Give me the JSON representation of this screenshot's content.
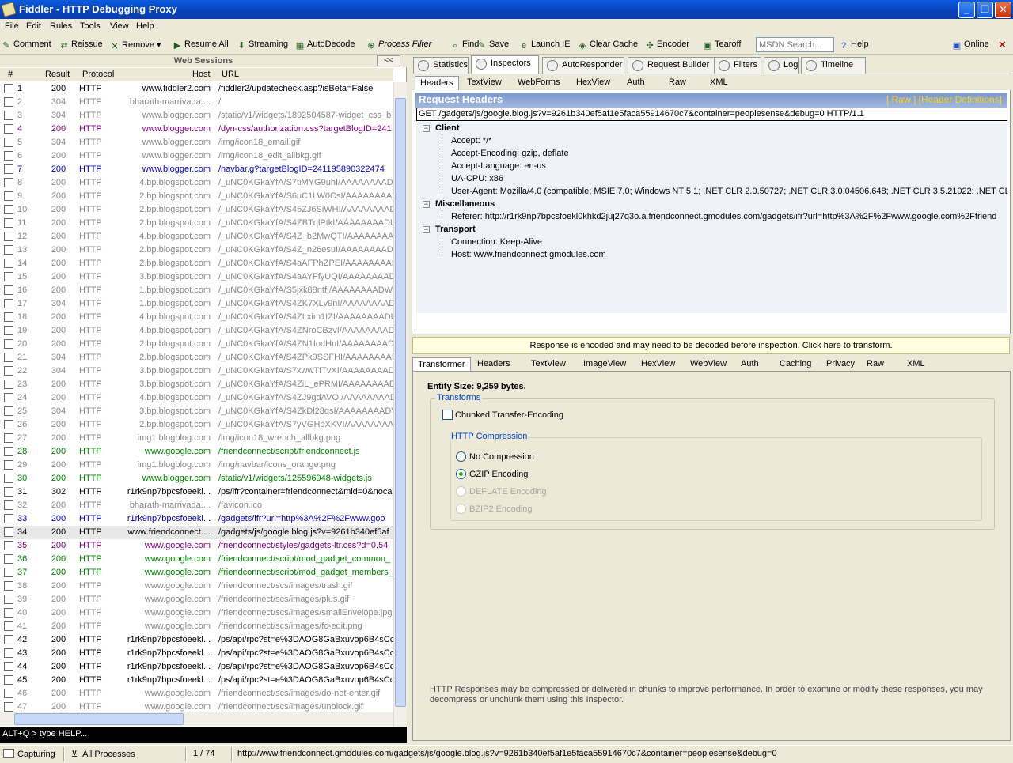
{
  "window": {
    "title": "Fiddler - HTTP Debugging Proxy",
    "controls": [
      "_",
      "❐",
      "✕"
    ]
  },
  "menu": [
    "File",
    "Edit",
    "Rules",
    "Tools",
    "View",
    "Help"
  ],
  "toolbar": {
    "items": [
      {
        "label": "Comment",
        "icon": "comment-icon",
        "glyph": "✎"
      },
      {
        "label": "Reissue",
        "icon": "reissue-icon",
        "glyph": "⇄"
      },
      {
        "label": "Remove ▾",
        "icon": "remove-icon",
        "glyph": "✕"
      },
      {
        "label": "Resume All",
        "icon": "resume-icon",
        "glyph": "▶"
      },
      {
        "label": "Streaming",
        "icon": "streaming-icon",
        "glyph": "⬇"
      },
      {
        "label": "AutoDecode",
        "icon": "autodecode-icon",
        "glyph": "▦"
      },
      {
        "label": "Process Filter",
        "icon": "process-filter-icon",
        "glyph": "⊕"
      },
      {
        "label": "Find",
        "icon": "find-icon",
        "glyph": "⌕"
      },
      {
        "label": "Save",
        "icon": "save-icon",
        "glyph": "✎"
      },
      {
        "label": "Launch IE",
        "icon": "ie-icon",
        "glyph": "e"
      },
      {
        "label": "Clear Cache",
        "icon": "clear-cache-icon",
        "glyph": "◈"
      },
      {
        "label": "Encoder",
        "icon": "encoder-icon",
        "glyph": "✣"
      },
      {
        "label": "Tearoff",
        "icon": "tearoff-icon",
        "glyph": "▣"
      }
    ],
    "msdn_placeholder": "MSDN Search...",
    "help": "Help",
    "online": "Online",
    "close": "✕"
  },
  "sessions": {
    "title": "Web Sessions",
    "collapse": "<<",
    "columns": [
      "#",
      "Result",
      "Protocol",
      "Host",
      "URL"
    ],
    "rows": [
      {
        "n": "1",
        "r": "200",
        "p": "HTTP",
        "h": "www.fiddler2.com",
        "u": "/fiddler2/updatecheck.asp?isBeta=False",
        "c": "#000"
      },
      {
        "n": "2",
        "r": "304",
        "p": "HTTP",
        "h": "bharath-marrivada....",
        "u": "/",
        "c": "#888"
      },
      {
        "n": "3",
        "r": "304",
        "p": "HTTP",
        "h": "www.blogger.com",
        "u": "/static/v1/widgets/1892504587-widget_css_b",
        "c": "#888"
      },
      {
        "n": "4",
        "r": "200",
        "p": "HTTP",
        "h": "www.blogger.com",
        "u": "/dyn-css/authorization.css?targetBlogID=241",
        "c": "#800080"
      },
      {
        "n": "5",
        "r": "304",
        "p": "HTTP",
        "h": "www.blogger.com",
        "u": "/img/icon18_email.gif",
        "c": "#888"
      },
      {
        "n": "6",
        "r": "200",
        "p": "HTTP",
        "h": "www.blogger.com",
        "u": "/img/icon18_edit_allbkg.gif",
        "c": "#888"
      },
      {
        "n": "7",
        "r": "200",
        "p": "HTTP",
        "h": "www.blogger.com",
        "u": "/navbar.g?targetBlogID=241195890322474",
        "c": "#0000c0"
      },
      {
        "n": "8",
        "r": "200",
        "p": "HTTP",
        "h": "4.bp.blogspot.com",
        "u": "/_uNC0KGkaYfA/S7tiMYG9uhI/AAAAAAAADXY",
        "c": "#888"
      },
      {
        "n": "9",
        "r": "200",
        "p": "HTTP",
        "h": "2.bp.blogspot.com",
        "u": "/_uNC0KGkaYfA/S6uC1LW0CsI/AAAAAAAADX",
        "c": "#888"
      },
      {
        "n": "10",
        "r": "200",
        "p": "HTTP",
        "h": "2.bp.blogspot.com",
        "u": "/_uNC0KGkaYfA/S45ZJ6SiWHI/AAAAAAAADW",
        "c": "#888"
      },
      {
        "n": "11",
        "r": "200",
        "p": "HTTP",
        "h": "2.bp.blogspot.com",
        "u": "/_uNC0KGkaYfA/S4ZBTqlPtkI/AAAAAAAADUA",
        "c": "#888"
      },
      {
        "n": "12",
        "r": "200",
        "p": "HTTP",
        "h": "4.bp.blogspot.com",
        "u": "/_uNC0KGkaYfA/S4Z_b2MwQTI/AAAAAAAADV",
        "c": "#888"
      },
      {
        "n": "13",
        "r": "200",
        "p": "HTTP",
        "h": "2.bp.blogspot.com",
        "u": "/_uNC0KGkaYfA/S4Z_n26esuI/AAAAAAAADV",
        "c": "#888"
      },
      {
        "n": "14",
        "r": "200",
        "p": "HTTP",
        "h": "2.bp.blogspot.com",
        "u": "/_uNC0KGkaYfA/S4aAFPhZPEI/AAAAAAAADW",
        "c": "#888"
      },
      {
        "n": "15",
        "r": "200",
        "p": "HTTP",
        "h": "3.bp.blogspot.com",
        "u": "/_uNC0KGkaYfA/S4aAYFfyUQI/AAAAAAAADW",
        "c": "#888"
      },
      {
        "n": "16",
        "r": "200",
        "p": "HTTP",
        "h": "1.bp.blogspot.com",
        "u": "/_uNC0KGkaYfA/S5jxk88ntfI/AAAAAAAADW0",
        "c": "#888"
      },
      {
        "n": "17",
        "r": "304",
        "p": "HTTP",
        "h": "1.bp.blogspot.com",
        "u": "/_uNC0KGkaYfA/S4ZK7XLv9nI/AAAAAAAADU",
        "c": "#888"
      },
      {
        "n": "18",
        "r": "200",
        "p": "HTTP",
        "h": "4.bp.blogspot.com",
        "u": "/_uNC0KGkaYfA/S4ZLxim1IZI/AAAAAAAADUo",
        "c": "#888"
      },
      {
        "n": "19",
        "r": "200",
        "p": "HTTP",
        "h": "4.bp.blogspot.com",
        "u": "/_uNC0KGkaYfA/S4ZNroCBzvI/AAAAAAAADU",
        "c": "#888"
      },
      {
        "n": "20",
        "r": "200",
        "p": "HTTP",
        "h": "2.bp.blogspot.com",
        "u": "/_uNC0KGkaYfA/S4ZN1IodHuI/AAAAAAAADU",
        "c": "#888"
      },
      {
        "n": "21",
        "r": "304",
        "p": "HTTP",
        "h": "2.bp.blogspot.com",
        "u": "/_uNC0KGkaYfA/S4ZPk9SSFHI/AAAAAAAADW",
        "c": "#888"
      },
      {
        "n": "22",
        "r": "304",
        "p": "HTTP",
        "h": "3.bp.blogspot.com",
        "u": "/_uNC0KGkaYfA/S7xwwTfTvXI/AAAAAAAADY",
        "c": "#888"
      },
      {
        "n": "23",
        "r": "200",
        "p": "HTTP",
        "h": "3.bp.blogspot.com",
        "u": "/_uNC0KGkaYfA/S4ZiL_ePRMI/AAAAAAAADV",
        "c": "#888"
      },
      {
        "n": "24",
        "r": "200",
        "p": "HTTP",
        "h": "4.bp.blogspot.com",
        "u": "/_uNC0KGkaYfA/S4ZJ9gdAVOI/AAAAAAAADW",
        "c": "#888"
      },
      {
        "n": "25",
        "r": "304",
        "p": "HTTP",
        "h": "3.bp.blogspot.com",
        "u": "/_uNC0KGkaYfA/S4ZkDl28qsI/AAAAAAAADVo",
        "c": "#888"
      },
      {
        "n": "26",
        "r": "200",
        "p": "HTTP",
        "h": "2.bp.blogspot.com",
        "u": "/_uNC0KGkaYfA/S7yVGHoXKVI/AAAAAAAADY",
        "c": "#888"
      },
      {
        "n": "27",
        "r": "200",
        "p": "HTTP",
        "h": "img1.blogblog.com",
        "u": "/img/icon18_wrench_allbkg.png",
        "c": "#888"
      },
      {
        "n": "28",
        "r": "200",
        "p": "HTTP",
        "h": "www.google.com",
        "u": "/friendconnect/script/friendconnect.js",
        "c": "#008000"
      },
      {
        "n": "29",
        "r": "200",
        "p": "HTTP",
        "h": "img1.blogblog.com",
        "u": "/img/navbar/icons_orange.png",
        "c": "#888"
      },
      {
        "n": "30",
        "r": "200",
        "p": "HTTP",
        "h": "www.blogger.com",
        "u": "/static/v1/widgets/125596948-widgets.js",
        "c": "#008000"
      },
      {
        "n": "31",
        "r": "302",
        "p": "HTTP",
        "h": "r1rk9np7bpcsfoeekl...",
        "u": "/ps/ifr?container=friendconnect&mid=0&noca",
        "c": "#000"
      },
      {
        "n": "32",
        "r": "200",
        "p": "HTTP",
        "h": "bharath-marrivada....",
        "u": "/favicon.ico",
        "c": "#888"
      },
      {
        "n": "33",
        "r": "200",
        "p": "HTTP",
        "h": "r1rk9np7bpcsfoeekl...",
        "u": "/gadgets/ifr?url=http%3A%2F%2Fwww.goo",
        "c": "#0000c0"
      },
      {
        "n": "34",
        "r": "200",
        "p": "HTTP",
        "h": "www.friendconnect....",
        "u": "/gadgets/js/google.blog.js?v=9261b340ef5af",
        "c": "#000",
        "sel": true
      },
      {
        "n": "35",
        "r": "200",
        "p": "HTTP",
        "h": "www.google.com",
        "u": "/friendconnect/styles/gadgets-ltr.css?d=0.54",
        "c": "#800080"
      },
      {
        "n": "36",
        "r": "200",
        "p": "HTTP",
        "h": "www.google.com",
        "u": "/friendconnect/script/mod_gadget_common_",
        "c": "#008000"
      },
      {
        "n": "37",
        "r": "200",
        "p": "HTTP",
        "h": "www.google.com",
        "u": "/friendconnect/script/mod_gadget_members_",
        "c": "#008000"
      },
      {
        "n": "38",
        "r": "200",
        "p": "HTTP",
        "h": "www.google.com",
        "u": "/friendconnect/scs/images/trash.gif",
        "c": "#888"
      },
      {
        "n": "39",
        "r": "200",
        "p": "HTTP",
        "h": "www.google.com",
        "u": "/friendconnect/scs/images/plus.gif",
        "c": "#888"
      },
      {
        "n": "40",
        "r": "200",
        "p": "HTTP",
        "h": "www.google.com",
        "u": "/friendconnect/scs/images/smallEnvelope.jpg",
        "c": "#888"
      },
      {
        "n": "41",
        "r": "200",
        "p": "HTTP",
        "h": "www.google.com",
        "u": "/friendconnect/scs/images/fc-edit.png",
        "c": "#888"
      },
      {
        "n": "42",
        "r": "200",
        "p": "HTTP",
        "h": "r1rk9np7bpcsfoeekl...",
        "u": "/ps/api/rpc?st=e%3DAOG8GaBxuvop6B4sCcj",
        "c": "#000"
      },
      {
        "n": "43",
        "r": "200",
        "p": "HTTP",
        "h": "r1rk9np7bpcsfoeekl...",
        "u": "/ps/api/rpc?st=e%3DAOG8GaBxuvop6B4sCcj",
        "c": "#000"
      },
      {
        "n": "44",
        "r": "200",
        "p": "HTTP",
        "h": "r1rk9np7bpcsfoeekl...",
        "u": "/ps/api/rpc?st=e%3DAOG8GaBxuvop6B4sCcj",
        "c": "#000"
      },
      {
        "n": "45",
        "r": "200",
        "p": "HTTP",
        "h": "r1rk9np7bpcsfoeekl...",
        "u": "/ps/api/rpc?st=e%3DAOG8GaBxuvop6B4sCcj",
        "c": "#000"
      },
      {
        "n": "46",
        "r": "200",
        "p": "HTTP",
        "h": "www.google.com",
        "u": "/friendconnect/scs/images/do-not-enter.gif",
        "c": "#888"
      },
      {
        "n": "47",
        "r": "200",
        "p": "HTTP",
        "h": "www.google.com",
        "u": "/friendconnect/scs/images/unblock.gif",
        "c": "#888"
      }
    ],
    "quickexec": "ALT+Q > type HELP..."
  },
  "inspector_tabs": [
    "Statistics",
    "Inspectors",
    "AutoResponder",
    "Request Builder",
    "Filters",
    "Log",
    "Timeline"
  ],
  "request_tabs": [
    "Headers",
    "TextView",
    "WebForms",
    "HexView",
    "Auth",
    "Raw",
    "XML"
  ],
  "request": {
    "title": "Request Headers",
    "links": "[ Raw ]    [Header Definitions]",
    "line": "GET /gadgets/js/google.blog.js?v=9261b340ef5af1e5faca55914670c7&container=peoplesense&debug=0 HTTP/1.1",
    "groups": [
      {
        "name": "Client",
        "items": [
          "Accept: */*",
          "Accept-Encoding: gzip, deflate",
          "Accept-Language: en-us",
          "UA-CPU: x86",
          "User-Agent: Mozilla/4.0 (compatible; MSIE 7.0; Windows NT 5.1; .NET CLR 2.0.50727; .NET CLR 3.0.04506.648; .NET CLR 3.5.21022; .NET CLR 3"
        ]
      },
      {
        "name": "Miscellaneous",
        "items": [
          "Referer: http://r1rk9np7bpcsfoekl0khkd2juj27q3o.a.friendconnect.gmodules.com/gadgets/ifr?url=http%3A%2F%2Fwww.google.com%2Ffriend"
        ]
      },
      {
        "name": "Transport",
        "items": [
          "Connection: Keep-Alive",
          "Host: www.friendconnect.gmodules.com"
        ]
      }
    ]
  },
  "notice": "Response is encoded and may need to be decoded before inspection. Click here to transform.",
  "response_tabs": [
    "Transformer",
    "Headers",
    "TextView",
    "ImageView",
    "HexView",
    "WebView",
    "Auth",
    "Caching",
    "Privacy",
    "Raw",
    "XML"
  ],
  "transformer": {
    "entity": "Entity Size: 9,259 bytes.",
    "transforms_title": "Transforms",
    "chunked": "Chunked Transfer-Encoding",
    "compression_title": "HTTP Compression",
    "options": [
      "No Compression",
      "GZIP Encoding",
      "DEFLATE Encoding",
      "BZIP2 Encoding"
    ],
    "footer": "HTTP Responses may be compressed or delivered in chunks to improve performance.  In order to examine or modify these responses, you may decompress or unchunk them using this Inspector."
  },
  "status": {
    "capturing": "Capturing",
    "processes": "All Processes",
    "count": "1 / 74",
    "url": "http://www.friendconnect.gmodules.com/gadgets/js/google.blog.js?v=9261b340ef5af1e5faca55914670c7&container=peoplesense&debug=0"
  }
}
